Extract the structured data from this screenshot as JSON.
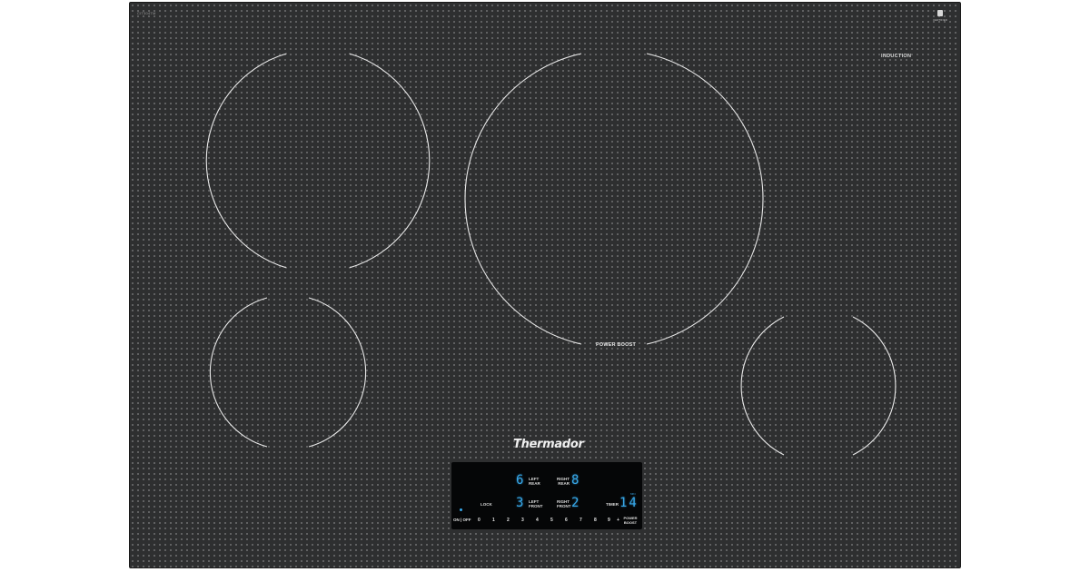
{
  "cooktop": {
    "model_code": "CIT304TM",
    "certification_label": "CERTIFIED",
    "type_label": "INDUCTION",
    "center_zone_label": "POWER BOOST",
    "brand": "Thermador"
  },
  "control_panel": {
    "left_rear": {
      "level": "6",
      "label_line1": "LEFT",
      "label_line2": "REAR"
    },
    "right_rear": {
      "level": "8",
      "label_line1": "RIGHT",
      "label_line2": "REAR"
    },
    "left_front": {
      "level": "3",
      "label_line1": "LEFT",
      "label_line2": "FRONT"
    },
    "right_front": {
      "level": "2",
      "label_line1": "RIGHT",
      "label_line2": "FRONT"
    },
    "lock_label": "LOCK",
    "timer_label": "TIMER",
    "timer_value": "14",
    "timer_unit": "MIN",
    "on_off_label": "ON | OFF",
    "slider_levels": [
      "0",
      "1",
      "2",
      "3",
      "4",
      "5",
      "6",
      "7",
      "8",
      "9",
      "+"
    ],
    "power_boost_line1": "POWER",
    "power_boost_line2": "BOOST",
    "accent_color": "#37a8ea"
  }
}
